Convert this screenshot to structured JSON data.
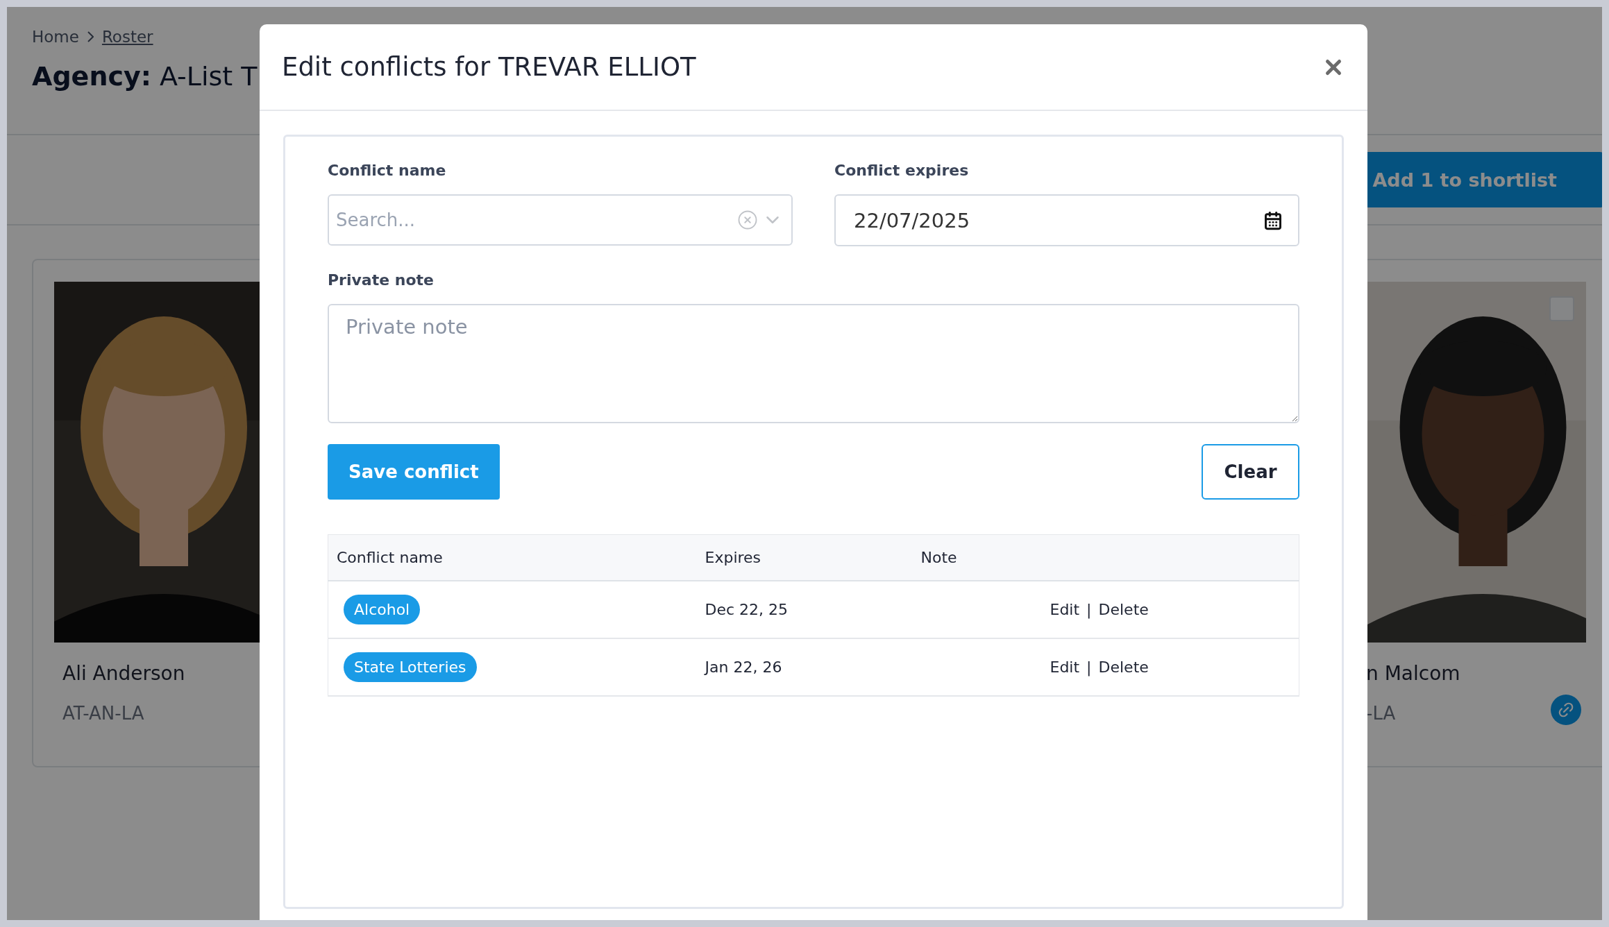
{
  "breadcrumb": [
    {
      "label": "Home",
      "link": false
    },
    {
      "label": "Roster",
      "link": true
    }
  ],
  "page_title": {
    "prefix": "Agency:",
    "name": "A-List T"
  },
  "toolbar": {
    "primary_button": "Add 1 to shortlist"
  },
  "cards": [
    {
      "name": "Ali Anderson",
      "code": "AT-AN-LA"
    },
    {
      "name": "n Malcom",
      "code": "-LA",
      "checked": false,
      "linked": true
    }
  ],
  "modal": {
    "title": "Edit conflicts for TREVAR ELLIOT",
    "fields": [
      {
        "kind": "select",
        "label": "Conflict name",
        "placeholder": "Search..."
      },
      {
        "kind": "date",
        "label": "Conflict expires",
        "value": "22/07/2025"
      },
      {
        "kind": "textarea",
        "label": "Private note",
        "placeholder": "Private note"
      }
    ],
    "save_button": "Save conflict",
    "clear_button": "Clear",
    "table": {
      "columns": [
        "Conflict name",
        "Expires",
        "Note"
      ],
      "separator": "|",
      "rows": [
        {
          "name": "Alcohol",
          "expires": "Dec 22, 25",
          "actions": [
            "Edit",
            "Delete"
          ]
        },
        {
          "name": "State Lotteries",
          "expires": "Jan 22, 26",
          "actions": [
            "Edit",
            "Delete"
          ]
        }
      ]
    }
  }
}
